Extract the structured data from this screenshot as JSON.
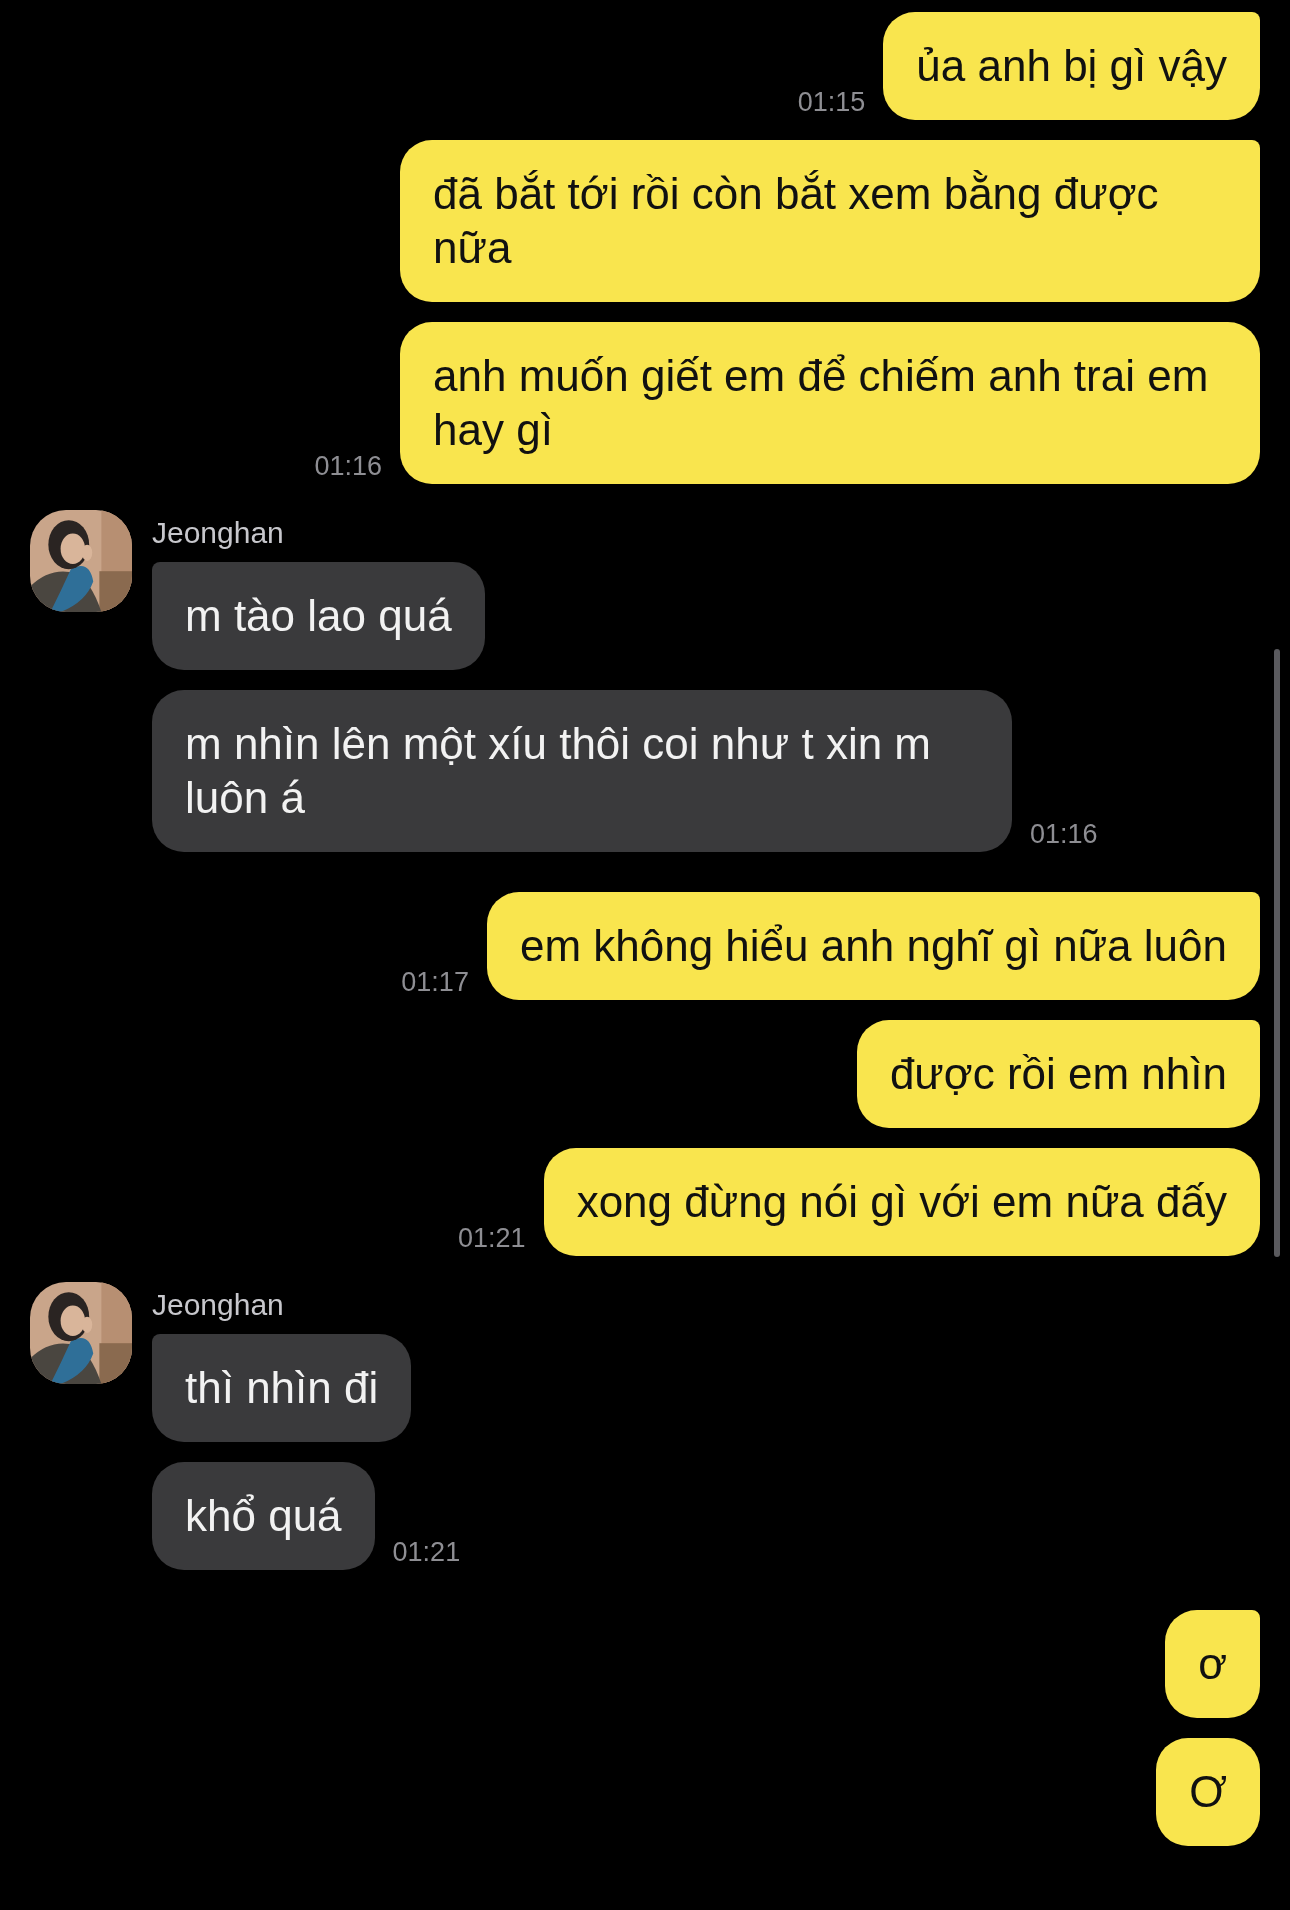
{
  "groups": [
    {
      "kind": "sent",
      "messages": [
        {
          "text": "ủa anh bị gì vậy",
          "time": "01:15"
        }
      ]
    },
    {
      "kind": "sent",
      "messages": [
        {
          "text": "đã bắt tới rồi còn bắt xem bằng được nữa"
        },
        {
          "text": "anh muốn giết em để chiếm anh trai em hay gì",
          "time": "01:16"
        }
      ]
    },
    {
      "kind": "received",
      "sender": "Jeonghan",
      "messages": [
        {
          "text": "m tào lao quá"
        },
        {
          "text": "m nhìn lên một xíu thôi coi như t xin m luôn á",
          "time": "01:16"
        }
      ]
    },
    {
      "kind": "sent",
      "messages": [
        {
          "text": "em không hiểu anh nghĩ gì nữa luôn",
          "time": "01:17"
        }
      ]
    },
    {
      "kind": "sent",
      "messages": [
        {
          "text": "được rồi em nhìn"
        },
        {
          "text": "xong đừng nói gì với em nữa đấy",
          "time": "01:21"
        }
      ]
    },
    {
      "kind": "received",
      "sender": "Jeonghan",
      "messages": [
        {
          "text": "thì nhìn đi"
        },
        {
          "text": "khổ quá",
          "time": "01:21"
        }
      ]
    },
    {
      "kind": "sent",
      "messages": [
        {
          "text": "ơ"
        },
        {
          "text": "Ơ"
        }
      ]
    }
  ]
}
